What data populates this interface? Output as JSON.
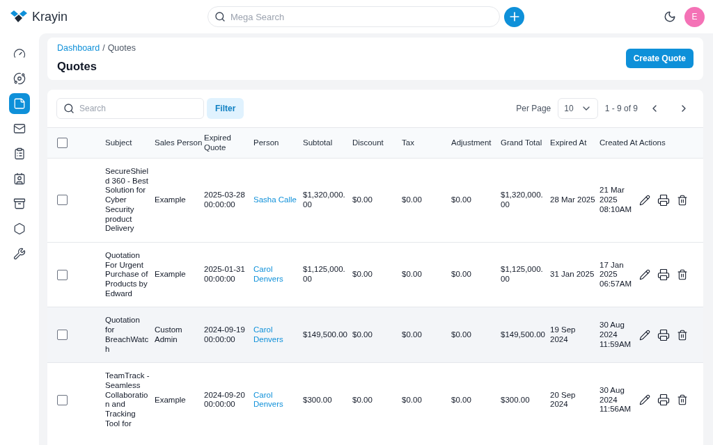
{
  "brand": {
    "name": "Krayin"
  },
  "top_bar": {
    "search": {
      "placeholder": "Mega Search"
    },
    "avatar": {
      "initial": "E"
    }
  },
  "sidebar": {
    "items": [
      {
        "selected": false
      },
      {
        "selected": false
      },
      {
        "selected": true
      },
      {
        "selected": false
      },
      {
        "selected": false
      },
      {
        "selected": false
      },
      {
        "selected": false
      },
      {
        "selected": false
      },
      {
        "selected": false
      }
    ]
  },
  "breadcrumb": [
    {
      "label": "Dashboard",
      "kind": "link"
    },
    {
      "label": "/",
      "kind": "separator"
    },
    {
      "label": "Quotes",
      "kind": "current"
    }
  ],
  "page_title": "Quotes",
  "create_button": "Create Quote",
  "toolbar": {
    "search": {
      "placeholder": "Search"
    },
    "filter": "Filter",
    "per_page_label": "Per Page",
    "per_page": "10",
    "range": "1 - 9 of 9"
  },
  "table": {
    "header_checkbox": {
      "checked": false
    },
    "columns": [
      "Subject",
      "Sales Person",
      "Expired Quote",
      "Person",
      "Subtotal",
      "Discount",
      "Tax",
      "Adjustment",
      "Grand Total",
      "Expired At",
      "Created At",
      "Actions"
    ],
    "rows": [
      {
        "checked": false,
        "highlighted": false,
        "subject": "SecureShield 360 - Best Solution for Cyber Security product Delivery",
        "sales_person": "Example",
        "expired_quote": "2025-03-28 00:00:00",
        "person": "Sasha Calle",
        "subtotal": "$1,320,000.00",
        "discount": "$0.00",
        "tax": "$0.00",
        "adjustment": "$0.00",
        "grand_total": "$1,320,000.00",
        "expired_at": "28 Mar 2025",
        "created_at": "21 Mar 2025 08:10AM"
      },
      {
        "checked": false,
        "highlighted": false,
        "subject": "Quotation For Urgent Purchase of Products by Edward",
        "sales_person": "Example",
        "expired_quote": "2025-01-31 00:00:00",
        "person": "Carol Denvers",
        "subtotal": "$1,125,000.00",
        "discount": "$0.00",
        "tax": "$0.00",
        "adjustment": "$0.00",
        "grand_total": "$1,125,000.00",
        "expired_at": "31 Jan 2025",
        "created_at": "17 Jan 2025 06:57AM"
      },
      {
        "checked": false,
        "highlighted": true,
        "subject": "Quotation for BreachWatch",
        "sales_person": "Custom Admin",
        "expired_quote": "2024-09-19 00:00:00",
        "person": "Carol Denvers",
        "subtotal": "$149,500.00",
        "discount": "$0.00",
        "tax": "$0.00",
        "adjustment": "$0.00",
        "grand_total": "$149,500.00",
        "expired_at": "19 Sep 2024",
        "created_at": "30 Aug 2024 11:59AM"
      },
      {
        "checked": false,
        "highlighted": false,
        "subject": "TeamTrack - Seamless Collaboration and Tracking Tool for",
        "sales_person": "Example",
        "expired_quote": "2024-09-20 00:00:00",
        "person": "Carol Denvers",
        "subtotal": "$300.00",
        "discount": "$0.00",
        "tax": "$0.00",
        "adjustment": "$0.00",
        "grand_total": "$300.00",
        "expired_at": "20 Sep 2024",
        "created_at": "30 Aug 2024 11:56AM"
      }
    ]
  }
}
